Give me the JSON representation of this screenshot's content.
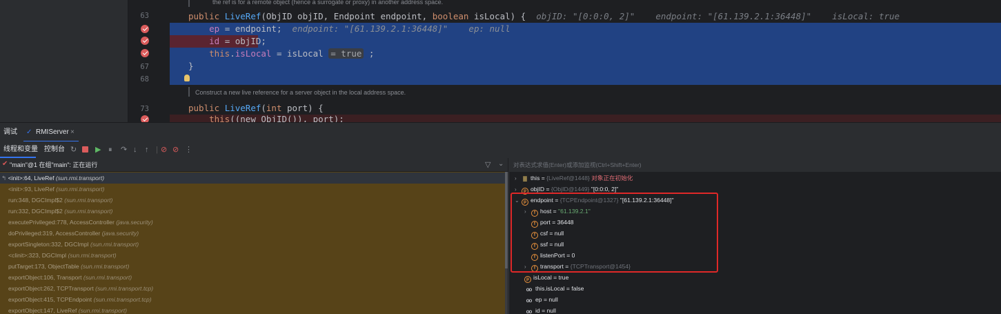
{
  "editor": {
    "doc_top": "the ref is for a remote object (hence a surrogate or proxy) in another address space.",
    "doc_mid": "Construct a new live reference for a server object in the local address space.",
    "line_numbers": [
      "63",
      "67",
      "68",
      "73"
    ],
    "line63": {
      "kw": "public",
      "fn": "LiveRef",
      "args": "(ObjID objID, Endpoint endpoint, ",
      "kw2": "boolean",
      "args2": " isLocal) {",
      "inline": "objID: \"[0:0:0, 2]\"    endpoint: \"[61.139.2.1:36448]\"    isLocal: true"
    },
    "line64": {
      "code_a": "ep",
      "code_b": " = endpoint;",
      "inline": "endpoint: \"[61.139.2.1:36448]\"    ep: null"
    },
    "line65": {
      "code_a": "id",
      "code_b": " = objID;"
    },
    "line66": {
      "kw": "this",
      "code_a": ".",
      "fld": "isLocal",
      "code_b": " = isLocal",
      "hint": "= true",
      "code_c": " ;"
    },
    "line67": "}",
    "line73": {
      "kw": "public",
      "fn": "LiveRef",
      "args": "(",
      "kw2": "int",
      "args2": " port) {"
    },
    "line74": {
      "kw": "this",
      "rest": "((new ObjID()), port);"
    }
  },
  "debug": {
    "tab_debug": "调试",
    "tab_config": "RMIServer",
    "tab_close": "×",
    "toolbar": {
      "threads_vars": "线程和变量",
      "console": "控制台"
    },
    "thread_status": "\"main\"@1 在组\"main\": 正在运行",
    "eval_placeholder": "对表达式求值(Enter)或添加监视(Ctrl+Shift+Enter)"
  },
  "frames": [
    {
      "method": "<init>:64, LiveRef",
      "pkg": "(sun.rmi.transport)"
    },
    {
      "method": "<init>:93, LiveRef",
      "pkg": "(sun.rmi.transport)"
    },
    {
      "method": "run:348, DGCImpl$2",
      "pkg": "(sun.rmi.transport)"
    },
    {
      "method": "run:332, DGCImpl$2",
      "pkg": "(sun.rmi.transport)"
    },
    {
      "method": "executePrivileged:778, AccessController",
      "pkg": "(java.security)"
    },
    {
      "method": "doPrivileged:319, AccessController",
      "pkg": "(java.security)"
    },
    {
      "method": "exportSingleton:332, DGCImpl",
      "pkg": "(sun.rmi.transport)"
    },
    {
      "method": "<clinit>:323, DGCImpl",
      "pkg": "(sun.rmi.transport)"
    },
    {
      "method": "putTarget:173, ObjectTable",
      "pkg": "(sun.rmi.transport)"
    },
    {
      "method": "exportObject:106, Transport",
      "pkg": "(sun.rmi.transport)"
    },
    {
      "method": "exportObject:262, TCPTransport",
      "pkg": "(sun.rmi.transport.tcp)"
    },
    {
      "method": "exportObject:415, TCPEndpoint",
      "pkg": "(sun.rmi.transport.tcp)"
    },
    {
      "method": "exportObject:147, LiveRef",
      "pkg": "(sun.rmi.transport)"
    }
  ],
  "variables": [
    {
      "name": "this",
      "eq": " = ",
      "type": "{LiveRef@1448}",
      "extra": " 对象正在初始化"
    },
    {
      "name": "objID",
      "eq": " = ",
      "type": "{ObjID@1449}",
      "value": " \"[0:0:0, 2]\""
    },
    {
      "name": "endpoint",
      "eq": " = ",
      "type": "{TCPEndpoint@1327}",
      "value": " \"[61.139.2.1:36448]\""
    },
    {
      "name": "host",
      "eq": " = ",
      "value": "\"61.139.2.1\""
    },
    {
      "name": "port",
      "eq": " = ",
      "value": "36448"
    },
    {
      "name": "csf",
      "eq": " = ",
      "value": "null"
    },
    {
      "name": "ssf",
      "eq": " = ",
      "value": "null"
    },
    {
      "name": "listenPort",
      "eq": " = ",
      "value": "0"
    },
    {
      "name": "transport",
      "eq": " = ",
      "type": "{TCPTransport@1454}"
    },
    {
      "name": "isLocal",
      "eq": " = ",
      "value": "true"
    },
    {
      "name": "this.isLocal",
      "eq": " = ",
      "value": "false"
    },
    {
      "name": "ep",
      "eq": " = ",
      "value": "null"
    },
    {
      "name": "id",
      "eq": " = ",
      "value": "null"
    }
  ],
  "colors": {
    "selection": "#214283",
    "breakpoint": "#db5c5c",
    "frames_bg": "#574318",
    "highlight_box": "#e02828",
    "accent": "#3574f0"
  }
}
